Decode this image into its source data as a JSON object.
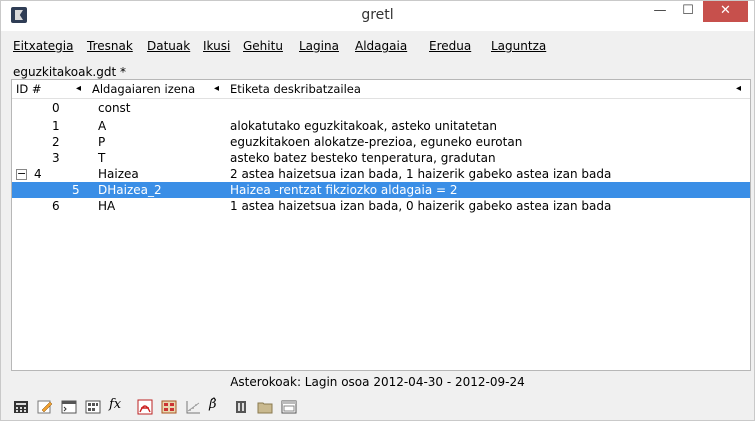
{
  "window": {
    "title": "gretl"
  },
  "menubar": [
    {
      "label": "Eitxategia"
    },
    {
      "label": "Tresnak"
    },
    {
      "label": "Datuak"
    },
    {
      "label": "Ikusi"
    },
    {
      "label": "Gehitu"
    },
    {
      "label": "Lagina"
    },
    {
      "label": "Aldagaia"
    },
    {
      "label": "Eredua"
    },
    {
      "label": "Laguntza"
    }
  ],
  "file": {
    "name": "eguzkitakoak.gdt *"
  },
  "table": {
    "headers": [
      "ID #",
      "Aldagaiaren izena",
      "Etiketa deskribatzailea"
    ],
    "rows": [
      {
        "id": "0",
        "name": "const",
        "label": ""
      },
      {
        "id": "1",
        "name": "A",
        "label": "alokatutako eguzkitakoak, asteko unitatetan"
      },
      {
        "id": "2",
        "name": "P",
        "label": "eguzkitakoen alokatze-prezioa, eguneko eurotan"
      },
      {
        "id": "3",
        "name": "T",
        "label": "asteko batez besteko tenperatura, gradutan"
      },
      {
        "id": "4",
        "name": "Haizea",
        "label": "2 astea haizetsua izan bada, 1 haizerik gabeko astea izan bada",
        "expander": "−"
      },
      {
        "id": "5",
        "name": "DHaizea_2",
        "label": "Haizea -rentzat fikziozko aldagaia = 2",
        "selected": true
      },
      {
        "id": "6",
        "name": "HA",
        "label": "1 astea haizetsua izan bada, 0 haizerik gabeko astea izan bada"
      }
    ]
  },
  "status": {
    "text": "Asterokoak: Lagin osoa 2012-04-30 - 2012-09-24"
  },
  "toolbar": [
    {
      "icon": "calculator-icon"
    },
    {
      "icon": "edit-icon"
    },
    {
      "icon": "terminal-icon"
    },
    {
      "icon": "session-icon"
    },
    {
      "icon": "function-icon",
      "text": "fx"
    },
    {
      "icon": "pdf-icon"
    },
    {
      "icon": "icon-view-icon"
    },
    {
      "icon": "plot-icon"
    },
    {
      "icon": "model-icon",
      "text": "β̂"
    },
    {
      "icon": "database-icon"
    },
    {
      "icon": "folder-icon"
    },
    {
      "icon": "window-icon"
    }
  ],
  "colors": {
    "selection": "#3a8ee6",
    "close_button": "#c7504c"
  }
}
